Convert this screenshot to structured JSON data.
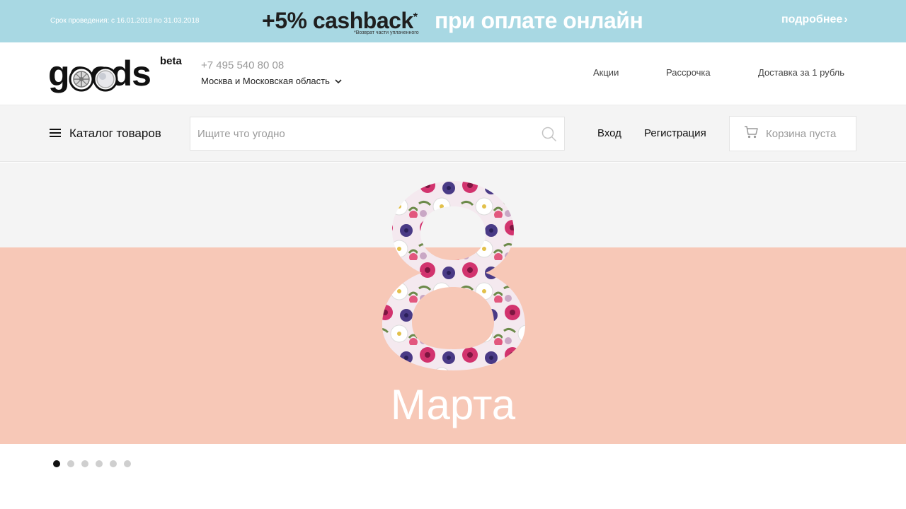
{
  "promo": {
    "period": "Срок проведения: с 16.01.2018 по 31.03.2018",
    "cashback": "+5% cashback",
    "asterisk": "*",
    "note": "*Возврат части уплаченного",
    "online": "при оплате онлайн",
    "more": "подробнее",
    "more_chevron": "›"
  },
  "header": {
    "logo_text": "goods",
    "logo_beta": "beta",
    "phone": "+7 495 540 80 08",
    "region": "Москва и Московская область",
    "links": [
      "Акции",
      "Рассрочка",
      "Доставка за 1 рубль"
    ]
  },
  "searchbar": {
    "catalog_label": "Каталог товаров",
    "search_placeholder": "Ищите что угодно",
    "login": "Вход",
    "register": "Регистрация",
    "cart_label": "Корзина пуста"
  },
  "hero": {
    "number": "8",
    "title": "Марта",
    "bg_top": "#f4f4f4",
    "bg_bottom": "#f7c8b7"
  },
  "slider": {
    "dot_count": 6,
    "active_index": 0
  },
  "colors": {
    "promo_bg": "#a8d8e3",
    "accent_dark": "#111111"
  },
  "icons": {
    "menu": "hamburger-icon",
    "search": "search-icon",
    "cart": "cart-icon",
    "region_dropdown": "chevron-down-icon"
  }
}
